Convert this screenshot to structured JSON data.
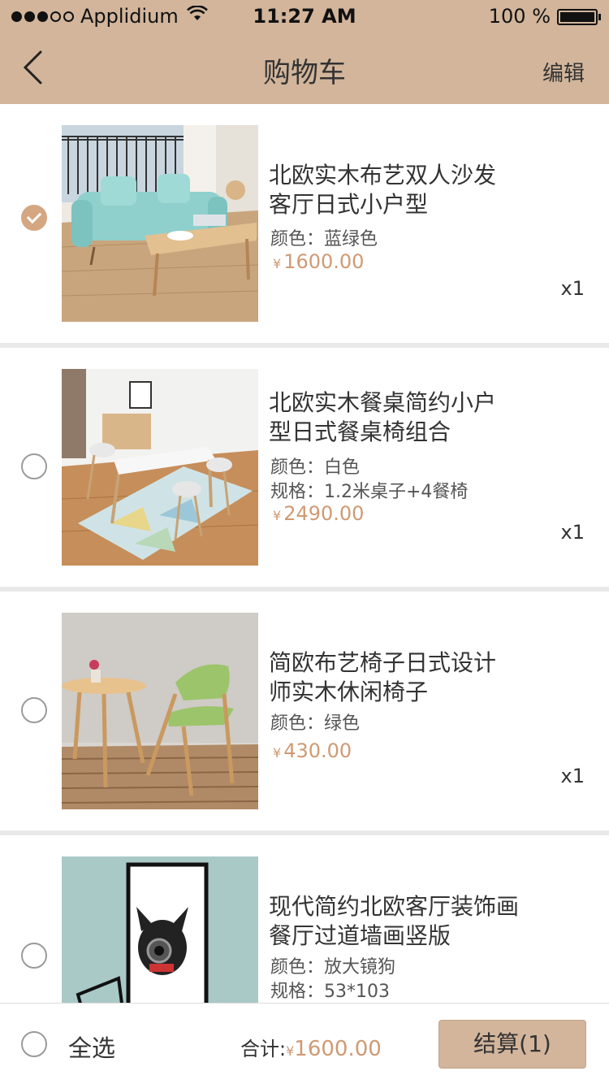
{
  "status_bar": {
    "carrier": "Applidium",
    "signal_dots": [
      true,
      true,
      true,
      false,
      false
    ],
    "time": "11:27 AM",
    "battery": "100 %",
    "battery_level": 1.0
  },
  "nav": {
    "title": "购物车",
    "edit_label": "编辑",
    "back_icon": "chevron-left-icon"
  },
  "items": [
    {
      "name_line1": "北欧实木布艺双人沙发",
      "name_line2": "客厅日式小户型",
      "attr1": "颜色：蓝绿色",
      "price_symbol": "¥",
      "price": "1600.00",
      "qty": "x1",
      "checked": true
    },
    {
      "name_line1": "北欧实木餐桌简约小户",
      "name_line2": "型日式餐桌椅组合",
      "attr1": "颜色：白色",
      "attr2": "规格：1.2米桌子+4餐椅",
      "price_symbol": "¥",
      "price": "2490.00",
      "qty": "x1",
      "checked": false
    },
    {
      "name_line1": "简欧布艺椅子日式设计",
      "name_line2": "师实木休闲椅子",
      "attr1": "颜色：绿色",
      "price_symbol": "¥",
      "price": "430.00",
      "qty": "x1",
      "checked": false
    },
    {
      "name_line1": "现代简约北欧客厅装饰画",
      "name_line2": "餐厅过道墙画竖版",
      "attr1": "颜色：放大镜狗",
      "attr2": "规格：53*103",
      "checked": false
    }
  ],
  "footer": {
    "select_all_label": "全选",
    "total_label": "合计:",
    "total_symbol": "¥",
    "total_amount": "1600.00",
    "checkout_label": "结算(1)"
  },
  "colors": {
    "accent": "#d2b59b",
    "price": "#cf9a73",
    "check": "#d4a682"
  }
}
